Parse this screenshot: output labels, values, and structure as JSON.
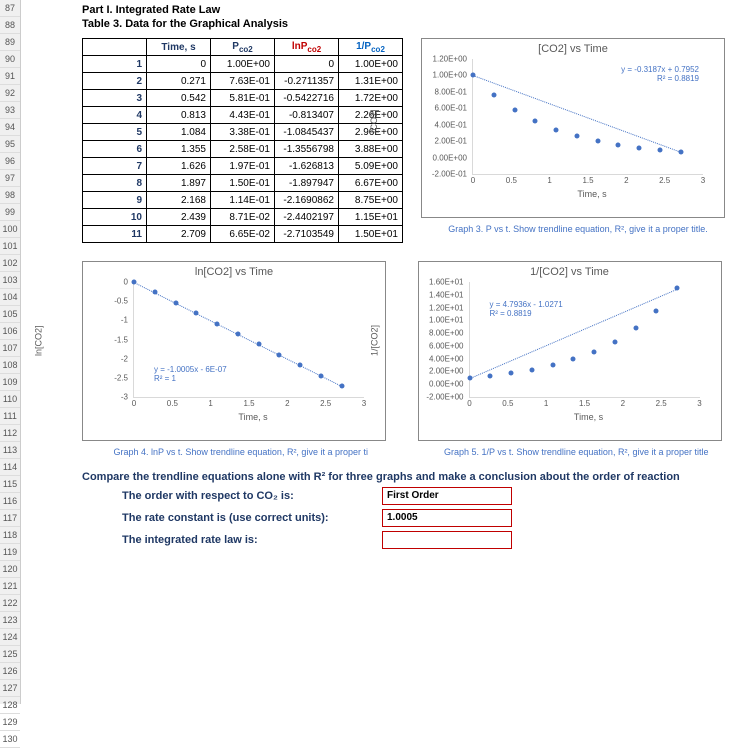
{
  "rows_start": 87,
  "rows_end": 130,
  "part_title": "Part I. Integrated Rate Law",
  "table_title": "Table 3. Data for the Graphical Analysis",
  "table": {
    "headers": {
      "idx": "",
      "time": "Time, s",
      "p": "Pco2",
      "lnp": "lnPco2",
      "invp": "1/Pco2"
    },
    "rows": [
      {
        "i": "1",
        "t": "0",
        "p": "1.00E+00",
        "ln": "0",
        "inv": "1.00E+00"
      },
      {
        "i": "2",
        "t": "0.271",
        "p": "7.63E-01",
        "ln": "-0.2711357",
        "inv": "1.31E+00"
      },
      {
        "i": "3",
        "t": "0.542",
        "p": "5.81E-01",
        "ln": "-0.5422716",
        "inv": "1.72E+00"
      },
      {
        "i": "4",
        "t": "0.813",
        "p": "4.43E-01",
        "ln": "-0.813407",
        "inv": "2.26E+00"
      },
      {
        "i": "5",
        "t": "1.084",
        "p": "3.38E-01",
        "ln": "-1.0845437",
        "inv": "2.96E+00"
      },
      {
        "i": "6",
        "t": "1.355",
        "p": "2.58E-01",
        "ln": "-1.3556798",
        "inv": "3.88E+00"
      },
      {
        "i": "7",
        "t": "1.626",
        "p": "1.97E-01",
        "ln": "-1.626813",
        "inv": "5.09E+00"
      },
      {
        "i": "8",
        "t": "1.897",
        "p": "1.50E-01",
        "ln": "-1.897947",
        "inv": "6.67E+00"
      },
      {
        "i": "9",
        "t": "2.168",
        "p": "1.14E-01",
        "ln": "-2.1690862",
        "inv": "8.75E+00"
      },
      {
        "i": "10",
        "t": "2.439",
        "p": "8.71E-02",
        "ln": "-2.4402197",
        "inv": "1.15E+01"
      },
      {
        "i": "11",
        "t": "2.709",
        "p": "6.65E-02",
        "ln": "-2.7103549",
        "inv": "1.50E+01"
      }
    ]
  },
  "chart_data": [
    {
      "id": "chart-co2",
      "type": "scatter",
      "title": "[CO2] vs Time",
      "xlabel": "Time, s",
      "ylabel": "[CO2]",
      "x": [
        0,
        0.271,
        0.542,
        0.813,
        1.084,
        1.355,
        1.626,
        1.897,
        2.168,
        2.439,
        2.709
      ],
      "y": [
        1.0,
        0.763,
        0.581,
        0.443,
        0.338,
        0.258,
        0.197,
        0.15,
        0.114,
        0.0871,
        0.0665
      ],
      "xlim": [
        0,
        3
      ],
      "ylim": [
        -0.2,
        1.2
      ],
      "xticks": [
        "0",
        "0.5",
        "1",
        "1.5",
        "2",
        "2.5",
        "3"
      ],
      "yticks": [
        "-2.00E-01",
        "0.00E+00",
        "2.00E-01",
        "4.00E-01",
        "6.00E-01",
        "8.00E-01",
        "1.00E+00",
        "1.20E+00"
      ],
      "trend_eqn": "y = -0.3187x + 0.7952",
      "r2": "R² = 0.8819",
      "caption": "Graph 3. P vs t. Show trendline equation, R², give it a proper title."
    },
    {
      "id": "chart-ln",
      "type": "scatter",
      "title": "ln[CO2] vs Time",
      "xlabel": "Time, s",
      "ylabel": "ln[CO2]",
      "x": [
        0,
        0.271,
        0.542,
        0.813,
        1.084,
        1.355,
        1.626,
        1.897,
        2.168,
        2.439,
        2.709
      ],
      "y": [
        0,
        -0.271,
        -0.542,
        -0.813,
        -1.085,
        -1.356,
        -1.627,
        -1.898,
        -2.169,
        -2.44,
        -2.71
      ],
      "xlim": [
        0,
        3
      ],
      "ylim": [
        -3,
        0
      ],
      "xticks": [
        "0",
        "0.5",
        "1",
        "1.5",
        "2",
        "2.5",
        "3"
      ],
      "yticks": [
        "-3",
        "-2.5",
        "-2",
        "-1.5",
        "-1",
        "-0.5",
        "0"
      ],
      "trend_eqn": "y = -1.0005x - 6E-07",
      "r2": "R² = 1",
      "caption": "Graph 4. lnP vs t. Show trendline equation, R², give it a proper ti"
    },
    {
      "id": "chart-inv",
      "type": "scatter",
      "title": "1/[CO2] vs Time",
      "xlabel": "Time, s",
      "ylabel": "1/[CO2]",
      "x": [
        0,
        0.271,
        0.542,
        0.813,
        1.084,
        1.355,
        1.626,
        1.897,
        2.168,
        2.439,
        2.709
      ],
      "y": [
        1.0,
        1.31,
        1.72,
        2.26,
        2.96,
        3.88,
        5.09,
        6.67,
        8.75,
        11.5,
        15.0
      ],
      "xlim": [
        0,
        3
      ],
      "ylim": [
        -2,
        16
      ],
      "xticks": [
        "0",
        "0.5",
        "1",
        "1.5",
        "2",
        "2.5",
        "3"
      ],
      "yticks": [
        "-2.00E+00",
        "0.00E+00",
        "2.00E+00",
        "4.00E+00",
        "6.00E+00",
        "8.00E+00",
        "1.00E+01",
        "1.20E+01",
        "1.40E+01",
        "1.60E+01"
      ],
      "trend_eqn": "y = 4.7936x - 1.0271",
      "r2": "R² = 0.8819",
      "caption": "Graph 5. 1/P vs t. Show trendline equation, R², give it a proper title"
    }
  ],
  "conclusion": {
    "head": "Compare the trendline equations alone with R² for three graphs and make a conclusion about the order of reaction",
    "q1": "The order with respect to CO₂ is:",
    "a1": "First Order",
    "q2": "The rate constant is (use correct units):",
    "a2": "1.0005",
    "q3": "The integrated rate law is:",
    "a3": ""
  }
}
